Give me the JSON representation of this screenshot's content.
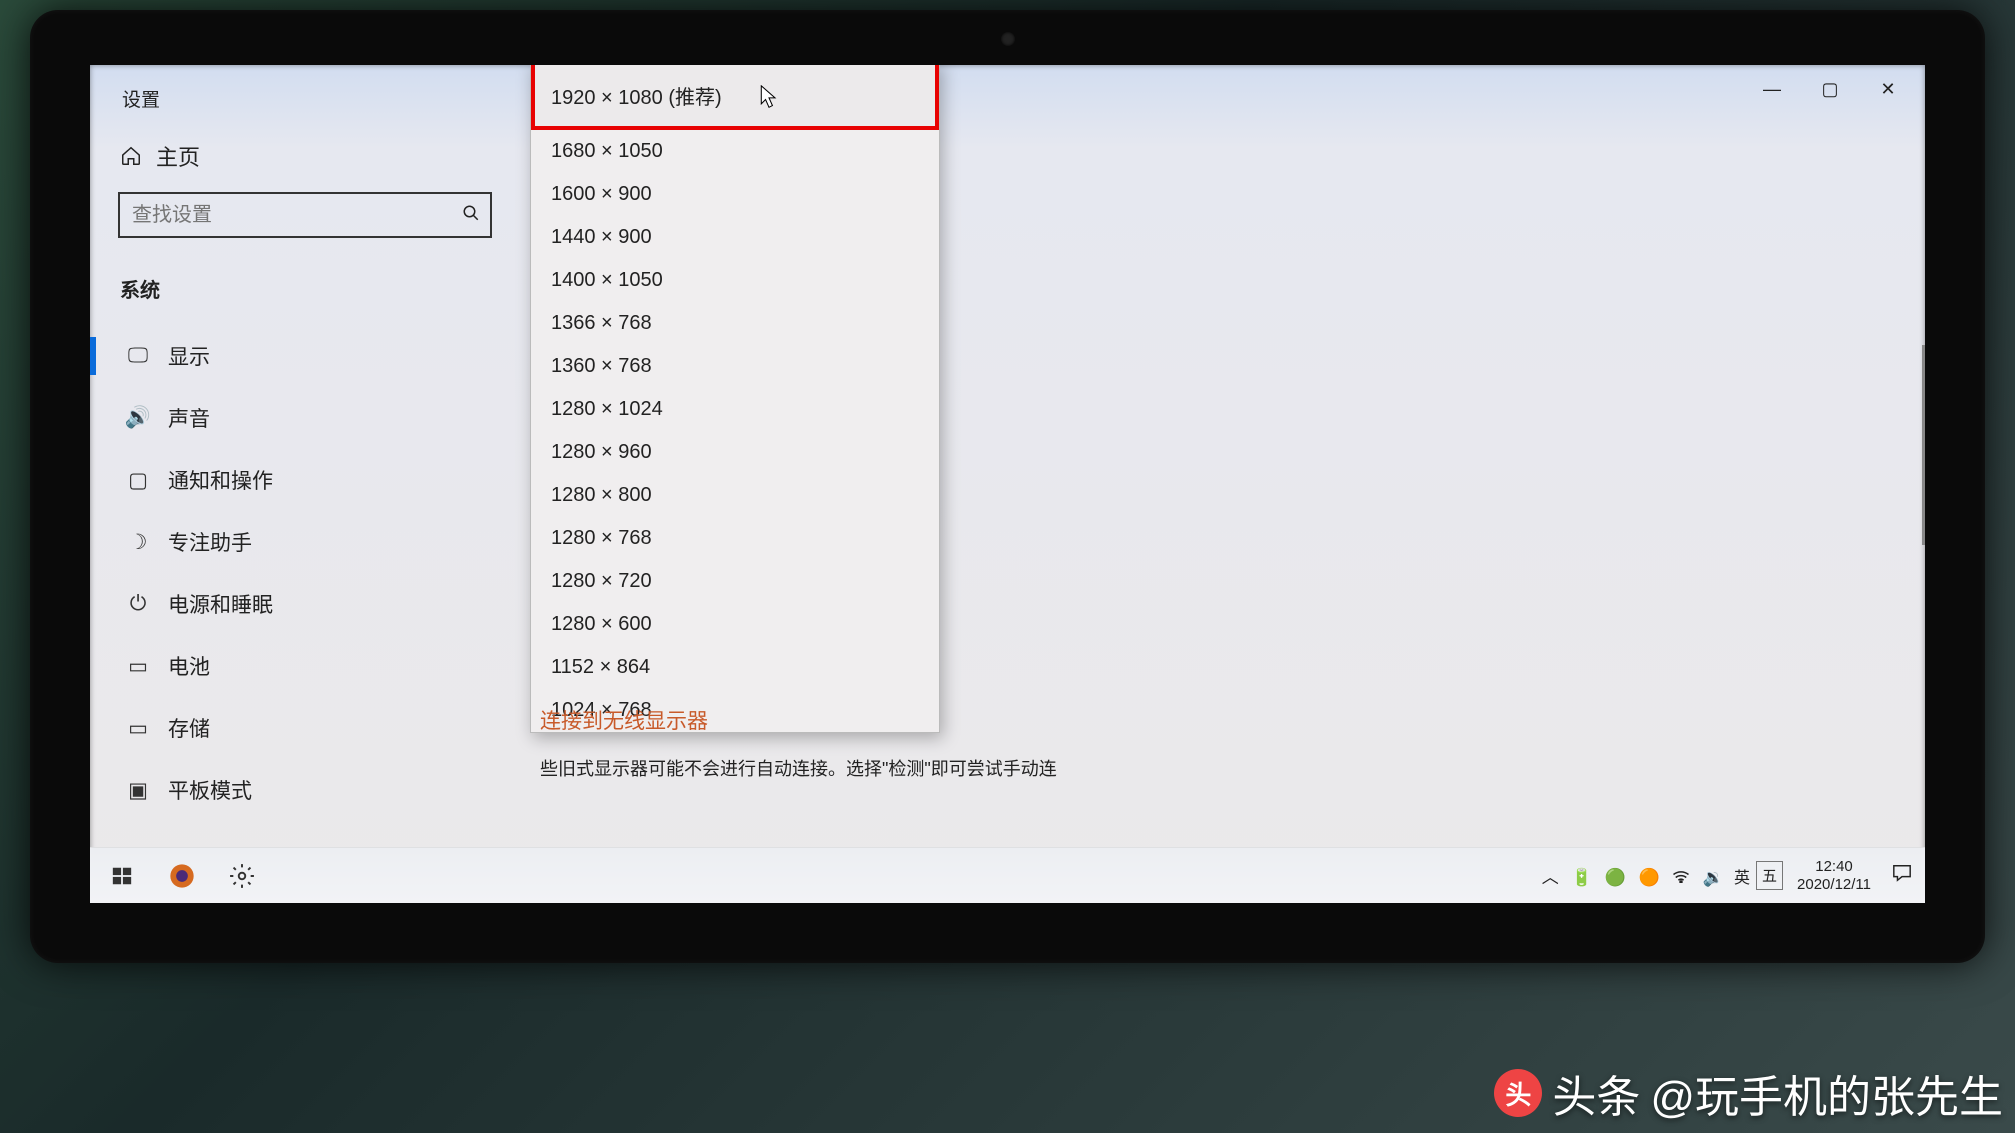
{
  "window": {
    "title": "设置",
    "home_label": "主页",
    "search_placeholder": "查找设置",
    "section_label": "系统"
  },
  "nav": {
    "items": [
      {
        "label": "显示",
        "icon": "🖵",
        "active": true
      },
      {
        "label": "声音",
        "icon": "🔊",
        "active": false
      },
      {
        "label": "通知和操作",
        "icon": "▢",
        "active": false
      },
      {
        "label": "专注助手",
        "icon": "☽",
        "active": false
      },
      {
        "label": "电源和睡眠",
        "icon": "⏻",
        "active": false
      },
      {
        "label": "电池",
        "icon": "▭",
        "active": false
      },
      {
        "label": "存储",
        "icon": "▭",
        "active": false
      },
      {
        "label": "平板模式",
        "icon": "▣",
        "active": false
      }
    ]
  },
  "resolution_dropdown": {
    "options": [
      "1920 × 1080 (推荐)",
      "1680 × 1050",
      "1600 × 900",
      "1440 × 900",
      "1400 × 1050",
      "1366 × 768",
      "1360 × 768",
      "1280 × 1024",
      "1280 × 960",
      "1280 × 800",
      "1280 × 768",
      "1280 × 720",
      "1280 × 600",
      "1152 × 864",
      "1024 × 768"
    ],
    "highlighted_index": 0
  },
  "links": {
    "wireless_display": "连接到无线显示器",
    "cutoff": "些旧式显示器可能不会进行自动连接。选择\"检测\"即可尝试手动连"
  },
  "window_controls": {
    "min": "—",
    "max": "▢",
    "close": "✕"
  },
  "taskbar": {
    "tray_up": "︿",
    "ime_lang": "英",
    "ime_mode": "五",
    "time": "12:40",
    "date": "2020/12/11"
  },
  "watermark": {
    "label": "头条",
    "author": "@玩手机的张先生"
  }
}
